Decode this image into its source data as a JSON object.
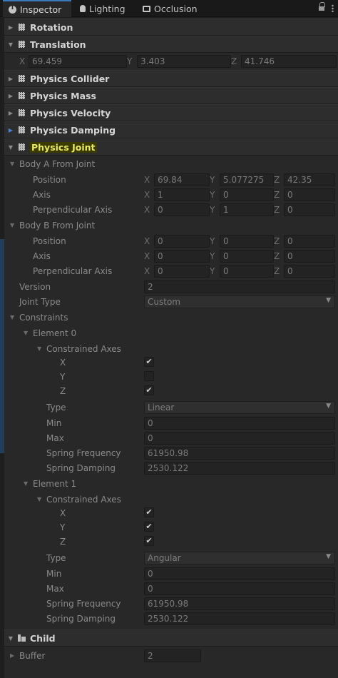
{
  "tabs": [
    {
      "label": "Inspector",
      "icon": "info-icon",
      "active": true
    },
    {
      "label": "Lighting",
      "icon": "lightbulb-icon",
      "active": false
    },
    {
      "label": "Occlusion",
      "icon": "occlusion-icon",
      "active": false
    }
  ],
  "components": {
    "rotation": "Rotation",
    "translation": {
      "title": "Translation",
      "x_label": "X",
      "x": "69.459",
      "y_label": "Y",
      "y": "3.403",
      "z_label": "Z",
      "z": "41.746"
    },
    "physics_collider": "Physics Collider",
    "physics_mass": "Physics Mass",
    "physics_velocity": "Physics Velocity",
    "physics_damping": "Physics Damping",
    "physics_joint": "Physics Joint",
    "child": "Child"
  },
  "joint": {
    "body_a": {
      "title": "Body A From Joint",
      "position": {
        "label": "Position",
        "x": "69.84",
        "y": "5.077275",
        "z": "42.35"
      },
      "axis": {
        "label": "Axis",
        "x": "1",
        "y": "0",
        "z": "0"
      },
      "perp": {
        "label": "Perpendicular Axis",
        "x": "0",
        "y": "1",
        "z": "0"
      }
    },
    "body_b": {
      "title": "Body B From Joint",
      "position": {
        "label": "Position",
        "x": "0",
        "y": "0",
        "z": "0"
      },
      "axis": {
        "label": "Axis",
        "x": "0",
        "y": "0",
        "z": "0"
      },
      "perp": {
        "label": "Perpendicular Axis",
        "x": "0",
        "y": "0",
        "z": "0"
      }
    },
    "version_label": "Version",
    "version": "2",
    "joint_type_label": "Joint Type",
    "joint_type": "Custom",
    "constraints_label": "Constraints",
    "elements": [
      {
        "title": "Element 0",
        "axes_label": "Constrained Axes",
        "x_label": "X",
        "y_label": "Y",
        "z_label": "Z",
        "x_checked": true,
        "y_checked": false,
        "z_checked": true,
        "type_label": "Type",
        "type": "Linear",
        "min_label": "Min",
        "min": "0",
        "max_label": "Max",
        "max": "0",
        "spring_freq_label": "Spring Frequency",
        "spring_freq": "61950.98",
        "spring_damp_label": "Spring Damping",
        "spring_damp": "2530.122"
      },
      {
        "title": "Element 1",
        "axes_label": "Constrained Axes",
        "x_label": "X",
        "y_label": "Y",
        "z_label": "Z",
        "x_checked": true,
        "y_checked": true,
        "z_checked": true,
        "type_label": "Type",
        "type": "Angular",
        "min_label": "Min",
        "min": "0",
        "max_label": "Max",
        "max": "0",
        "spring_freq_label": "Spring Frequency",
        "spring_freq": "61950.98",
        "spring_damp_label": "Spring Damping",
        "spring_damp": "2530.122"
      }
    ]
  },
  "child": {
    "buffer_label": "Buffer",
    "buffer": "2"
  },
  "axis_letters": {
    "x": "X",
    "y": "Y",
    "z": "Z"
  },
  "glyphs": {
    "check": "✔",
    "fold_open": "▼",
    "fold_closed": "▶",
    "dropdown": "▼"
  },
  "colors": {
    "accent": "#3a79bb",
    "highlight": "#e9e86a",
    "background": "#282828"
  }
}
